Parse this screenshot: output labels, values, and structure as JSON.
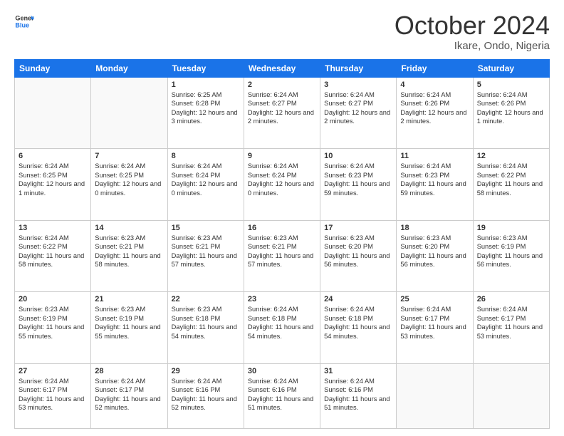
{
  "header": {
    "logo_general": "General",
    "logo_blue": "Blue",
    "month_title": "October 2024",
    "subtitle": "Ikare, Ondo, Nigeria"
  },
  "columns": [
    "Sunday",
    "Monday",
    "Tuesday",
    "Wednesday",
    "Thursday",
    "Friday",
    "Saturday"
  ],
  "weeks": [
    [
      {
        "day": "",
        "text": ""
      },
      {
        "day": "",
        "text": ""
      },
      {
        "day": "1",
        "text": "Sunrise: 6:25 AM\nSunset: 6:28 PM\nDaylight: 12 hours\nand 3 minutes."
      },
      {
        "day": "2",
        "text": "Sunrise: 6:24 AM\nSunset: 6:27 PM\nDaylight: 12 hours\nand 2 minutes."
      },
      {
        "day": "3",
        "text": "Sunrise: 6:24 AM\nSunset: 6:27 PM\nDaylight: 12 hours\nand 2 minutes."
      },
      {
        "day": "4",
        "text": "Sunrise: 6:24 AM\nSunset: 6:26 PM\nDaylight: 12 hours\nand 2 minutes."
      },
      {
        "day": "5",
        "text": "Sunrise: 6:24 AM\nSunset: 6:26 PM\nDaylight: 12 hours\nand 1 minute."
      }
    ],
    [
      {
        "day": "6",
        "text": "Sunrise: 6:24 AM\nSunset: 6:25 PM\nDaylight: 12 hours\nand 1 minute."
      },
      {
        "day": "7",
        "text": "Sunrise: 6:24 AM\nSunset: 6:25 PM\nDaylight: 12 hours\nand 0 minutes."
      },
      {
        "day": "8",
        "text": "Sunrise: 6:24 AM\nSunset: 6:24 PM\nDaylight: 12 hours\nand 0 minutes."
      },
      {
        "day": "9",
        "text": "Sunrise: 6:24 AM\nSunset: 6:24 PM\nDaylight: 12 hours\nand 0 minutes."
      },
      {
        "day": "10",
        "text": "Sunrise: 6:24 AM\nSunset: 6:23 PM\nDaylight: 11 hours\nand 59 minutes."
      },
      {
        "day": "11",
        "text": "Sunrise: 6:24 AM\nSunset: 6:23 PM\nDaylight: 11 hours\nand 59 minutes."
      },
      {
        "day": "12",
        "text": "Sunrise: 6:24 AM\nSunset: 6:22 PM\nDaylight: 11 hours\nand 58 minutes."
      }
    ],
    [
      {
        "day": "13",
        "text": "Sunrise: 6:24 AM\nSunset: 6:22 PM\nDaylight: 11 hours\nand 58 minutes."
      },
      {
        "day": "14",
        "text": "Sunrise: 6:23 AM\nSunset: 6:21 PM\nDaylight: 11 hours\nand 58 minutes."
      },
      {
        "day": "15",
        "text": "Sunrise: 6:23 AM\nSunset: 6:21 PM\nDaylight: 11 hours\nand 57 minutes."
      },
      {
        "day": "16",
        "text": "Sunrise: 6:23 AM\nSunset: 6:21 PM\nDaylight: 11 hours\nand 57 minutes."
      },
      {
        "day": "17",
        "text": "Sunrise: 6:23 AM\nSunset: 6:20 PM\nDaylight: 11 hours\nand 56 minutes."
      },
      {
        "day": "18",
        "text": "Sunrise: 6:23 AM\nSunset: 6:20 PM\nDaylight: 11 hours\nand 56 minutes."
      },
      {
        "day": "19",
        "text": "Sunrise: 6:23 AM\nSunset: 6:19 PM\nDaylight: 11 hours\nand 56 minutes."
      }
    ],
    [
      {
        "day": "20",
        "text": "Sunrise: 6:23 AM\nSunset: 6:19 PM\nDaylight: 11 hours\nand 55 minutes."
      },
      {
        "day": "21",
        "text": "Sunrise: 6:23 AM\nSunset: 6:19 PM\nDaylight: 11 hours\nand 55 minutes."
      },
      {
        "day": "22",
        "text": "Sunrise: 6:23 AM\nSunset: 6:18 PM\nDaylight: 11 hours\nand 54 minutes."
      },
      {
        "day": "23",
        "text": "Sunrise: 6:24 AM\nSunset: 6:18 PM\nDaylight: 11 hours\nand 54 minutes."
      },
      {
        "day": "24",
        "text": "Sunrise: 6:24 AM\nSunset: 6:18 PM\nDaylight: 11 hours\nand 54 minutes."
      },
      {
        "day": "25",
        "text": "Sunrise: 6:24 AM\nSunset: 6:17 PM\nDaylight: 11 hours\nand 53 minutes."
      },
      {
        "day": "26",
        "text": "Sunrise: 6:24 AM\nSunset: 6:17 PM\nDaylight: 11 hours\nand 53 minutes."
      }
    ],
    [
      {
        "day": "27",
        "text": "Sunrise: 6:24 AM\nSunset: 6:17 PM\nDaylight: 11 hours\nand 53 minutes."
      },
      {
        "day": "28",
        "text": "Sunrise: 6:24 AM\nSunset: 6:17 PM\nDaylight: 11 hours\nand 52 minutes."
      },
      {
        "day": "29",
        "text": "Sunrise: 6:24 AM\nSunset: 6:16 PM\nDaylight: 11 hours\nand 52 minutes."
      },
      {
        "day": "30",
        "text": "Sunrise: 6:24 AM\nSunset: 6:16 PM\nDaylight: 11 hours\nand 51 minutes."
      },
      {
        "day": "31",
        "text": "Sunrise: 6:24 AM\nSunset: 6:16 PM\nDaylight: 11 hours\nand 51 minutes."
      },
      {
        "day": "",
        "text": ""
      },
      {
        "day": "",
        "text": ""
      }
    ]
  ]
}
